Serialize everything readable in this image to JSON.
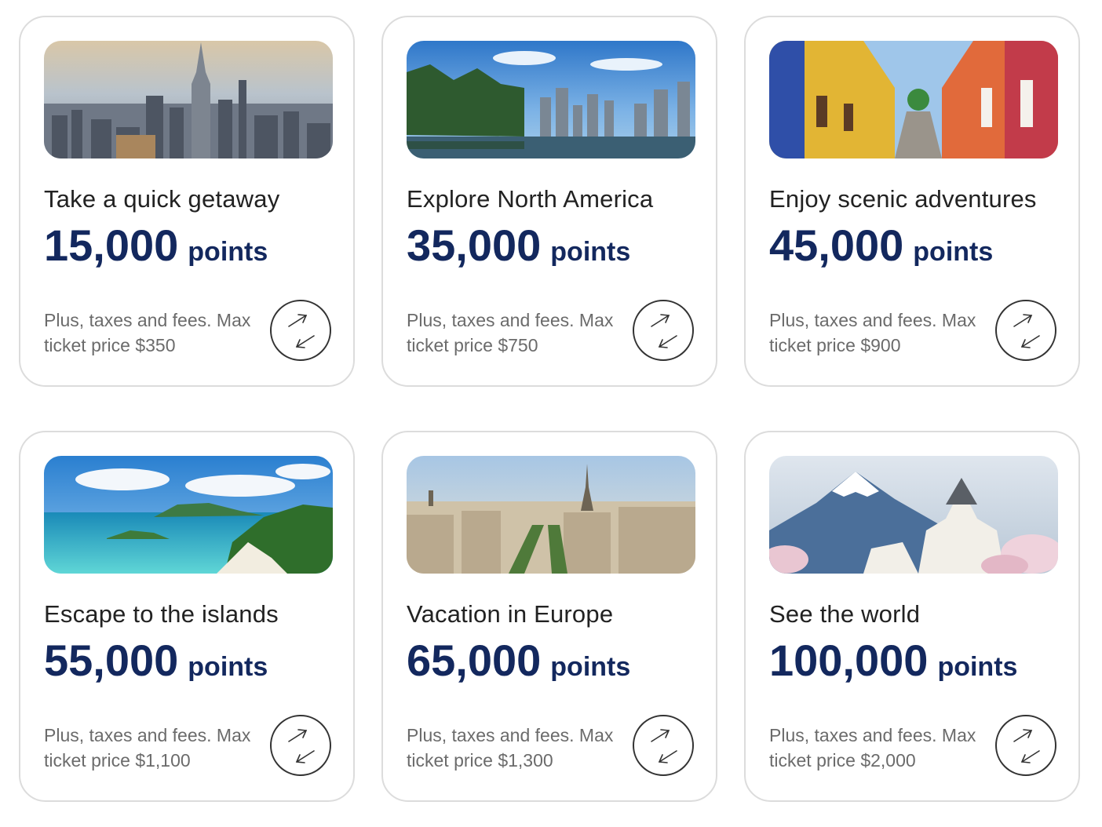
{
  "cards": [
    {
      "title": "Take a quick getaway",
      "points": "15,000",
      "unit": "points",
      "fine_line1": "Plus, taxes and fees. Max",
      "fine_line2": "ticket price $350",
      "image": "new-york-skyline"
    },
    {
      "title": "Explore North America",
      "points": "35,000",
      "unit": "points",
      "fine_line1": "Plus, taxes and fees. Max",
      "fine_line2": "ticket price $750",
      "image": "vancouver-skyline"
    },
    {
      "title": "Enjoy scenic adventures",
      "points": "45,000",
      "unit": "points",
      "fine_line1": "Plus, taxes and fees. Max",
      "fine_line2": "ticket price $900",
      "image": "colorful-street"
    },
    {
      "title": "Escape to the islands",
      "points": "55,000",
      "unit": "points",
      "fine_line1": "Plus, taxes and fees. Max",
      "fine_line2": "ticket price $1,100",
      "image": "tropical-beach"
    },
    {
      "title": "Vacation in Europe",
      "points": "65,000",
      "unit": "points",
      "fine_line1": "Plus, taxes and fees. Max",
      "fine_line2": "ticket price $1,300",
      "image": "paris-eiffel-tower"
    },
    {
      "title": "See the world",
      "points": "100,000",
      "unit": "points",
      "fine_line1": "Plus, taxes and fees. Max",
      "fine_line2": "ticket price $2,000",
      "image": "mount-fuji-castle"
    }
  ],
  "icons": {
    "flip": "flip-arrows-icon"
  },
  "colors": {
    "points": "#13285e",
    "title": "#222222",
    "fine": "#6b6b6b",
    "border": "#dcdcdc"
  }
}
